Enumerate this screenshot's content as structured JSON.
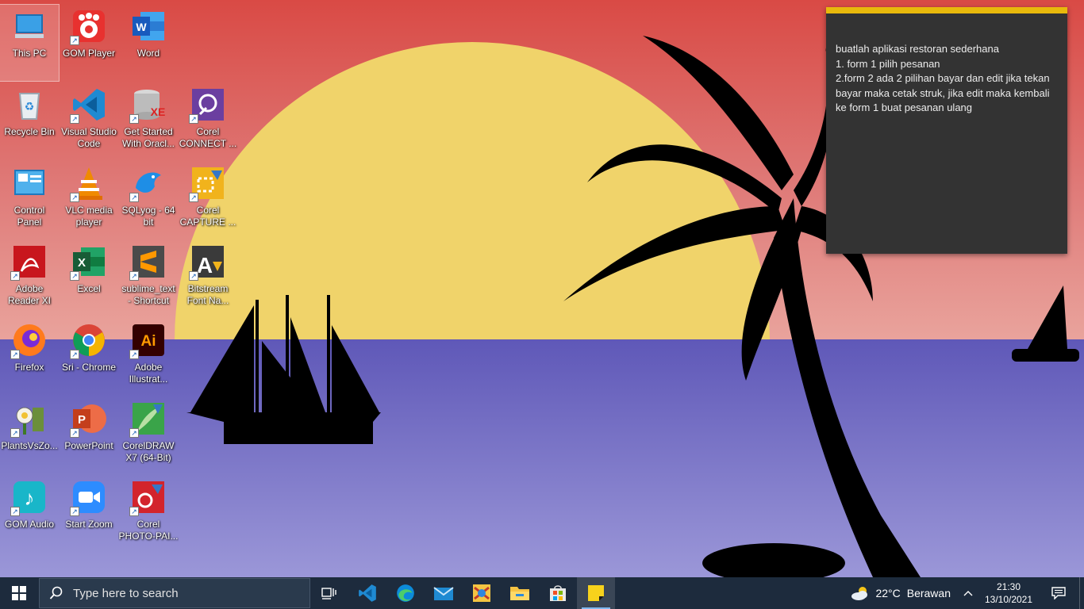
{
  "desktop": {
    "icons": [
      {
        "label": "This PC",
        "icon": "computer-icon"
      },
      {
        "label": "GOM Player",
        "icon": "gom-player-icon"
      },
      {
        "label": "Word",
        "icon": "word-icon"
      },
      {
        "label": "Recycle Bin",
        "icon": "recycle-bin-icon"
      },
      {
        "label": "Visual Studio\nCode",
        "icon": "vscode-icon"
      },
      {
        "label": "Get Started\nWith Oracl...",
        "icon": "oracle-database-icon"
      },
      {
        "label": "Corel\nCONNECT ...",
        "icon": "corel-connect-icon"
      },
      {
        "label": "Control\nPanel",
        "icon": "control-panel-icon"
      },
      {
        "label": "VLC media\nplayer",
        "icon": "vlc-icon"
      },
      {
        "label": "SQLyog - 64\nbit",
        "icon": "sqlyog-icon"
      },
      {
        "label": "Corel\nCAPTURE ...",
        "icon": "corel-capture-icon"
      },
      {
        "label": "Adobe\nReader XI",
        "icon": "adobe-reader-icon"
      },
      {
        "label": "Excel",
        "icon": "excel-icon"
      },
      {
        "label": "sublime_text\n- Shortcut",
        "icon": "sublime-text-icon"
      },
      {
        "label": "Bitstream\nFont Na...",
        "icon": "bitstream-font-icon"
      },
      {
        "label": "Firefox",
        "icon": "firefox-icon"
      },
      {
        "label": "Sri - Chrome",
        "icon": "chrome-icon"
      },
      {
        "label": "Adobe\nIllustrat...",
        "icon": "illustrator-icon"
      },
      {
        "label": "PlantsVsZo...",
        "icon": "plants-vs-zombies-icon"
      },
      {
        "label": "PowerPoint",
        "icon": "powerpoint-icon"
      },
      {
        "label": "CorelDRAW\nX7 (64-Bit)",
        "icon": "coreldraw-icon"
      },
      {
        "label": "GOM Audio",
        "icon": "gom-audio-icon"
      },
      {
        "label": "Start Zoom",
        "icon": "zoom-icon"
      },
      {
        "label": "Corel\nPHOTO-PAI...",
        "icon": "corel-photo-paint-icon"
      }
    ]
  },
  "sticky_note": {
    "text": "buatlah aplikasi restoran sederhana\n1. form 1 pilih pesanan\n2.form 2 ada 2 pilihan bayar dan edit jika tekan bayar maka cetak struk, jika edit maka kembali ke form 1 buat pesanan ulang",
    "accent_color": "#e8b90c"
  },
  "taskbar": {
    "search_placeholder": "Type here to search",
    "apps": [
      "task-view-icon",
      "vscode-icon",
      "edge-icon",
      "mail-icon",
      "game-icon",
      "file-explorer-icon",
      "microsoft-store-icon",
      "sticky-notes-icon"
    ],
    "weather": {
      "temp": "22°C",
      "condition": "Berawan",
      "icon": "partly-cloudy-icon"
    },
    "clock": {
      "time": "21:30",
      "date": "13/10/2021"
    }
  }
}
